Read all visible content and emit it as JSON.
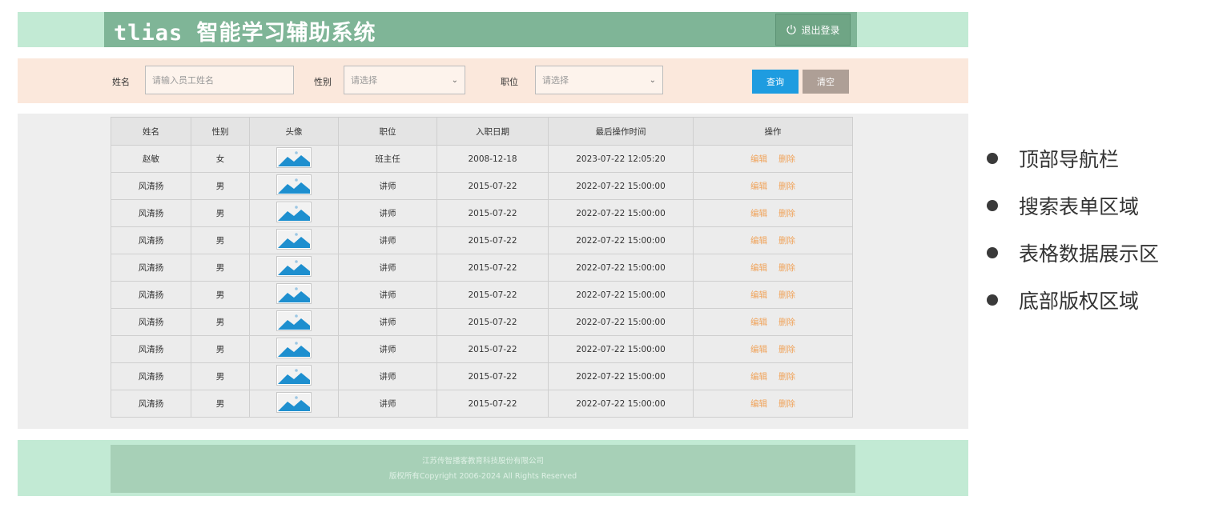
{
  "header": {
    "app_title": "tlias 智能学习辅助系统",
    "logout_label": "退出登录"
  },
  "search": {
    "name_label": "姓名",
    "name_placeholder": "请输入员工姓名",
    "gender_label": "性别",
    "gender_value": "请选择",
    "position_label": "职位",
    "position_value": "请选择",
    "query_label": "查询",
    "clear_label": "清空"
  },
  "table": {
    "columns": [
      "姓名",
      "性别",
      "头像",
      "职位",
      "入职日期",
      "最后操作时间",
      "操作"
    ],
    "edit_label": "编辑",
    "delete_label": "删除",
    "rows": [
      {
        "name": "赵敏",
        "gender": "女",
        "position": "班主任",
        "entry_date": "2008-12-18",
        "last_op": "2023-07-22 12:05:20"
      },
      {
        "name": "风清扬",
        "gender": "男",
        "position": "讲师",
        "entry_date": "2015-07-22",
        "last_op": "2022-07-22 15:00:00"
      },
      {
        "name": "风清扬",
        "gender": "男",
        "position": "讲师",
        "entry_date": "2015-07-22",
        "last_op": "2022-07-22 15:00:00"
      },
      {
        "name": "风清扬",
        "gender": "男",
        "position": "讲师",
        "entry_date": "2015-07-22",
        "last_op": "2022-07-22 15:00:00"
      },
      {
        "name": "风清扬",
        "gender": "男",
        "position": "讲师",
        "entry_date": "2015-07-22",
        "last_op": "2022-07-22 15:00:00"
      },
      {
        "name": "风清扬",
        "gender": "男",
        "position": "讲师",
        "entry_date": "2015-07-22",
        "last_op": "2022-07-22 15:00:00"
      },
      {
        "name": "风清扬",
        "gender": "男",
        "position": "讲师",
        "entry_date": "2015-07-22",
        "last_op": "2022-07-22 15:00:00"
      },
      {
        "name": "风清扬",
        "gender": "男",
        "position": "讲师",
        "entry_date": "2015-07-22",
        "last_op": "2022-07-22 15:00:00"
      },
      {
        "name": "风清扬",
        "gender": "男",
        "position": "讲师",
        "entry_date": "2015-07-22",
        "last_op": "2022-07-22 15:00:00"
      },
      {
        "name": "风清扬",
        "gender": "男",
        "position": "讲师",
        "entry_date": "2015-07-22",
        "last_op": "2022-07-22 15:00:00"
      }
    ]
  },
  "footer": {
    "company": "江苏传智播客教育科技股份有限公司",
    "copyright": "版权所有Copyright 2006-2024  All Rights Reserved"
  },
  "sections": [
    "顶部导航栏",
    "搜索表单区域",
    "表格数据展示区",
    "底部版权区域"
  ],
  "icons": {
    "logout": "power-icon",
    "avatar": "image-placeholder-icon",
    "select": "chevron-down-icon"
  },
  "colors": {
    "header_band": "#c2ead4",
    "header_bar": "#7fb597",
    "search_band": "#fbe8dc",
    "query_button": "#1e9ce0",
    "clear_button": "#ae9f96",
    "action_link": "#f0a35a",
    "footer_bar": "#a7d0b7"
  }
}
